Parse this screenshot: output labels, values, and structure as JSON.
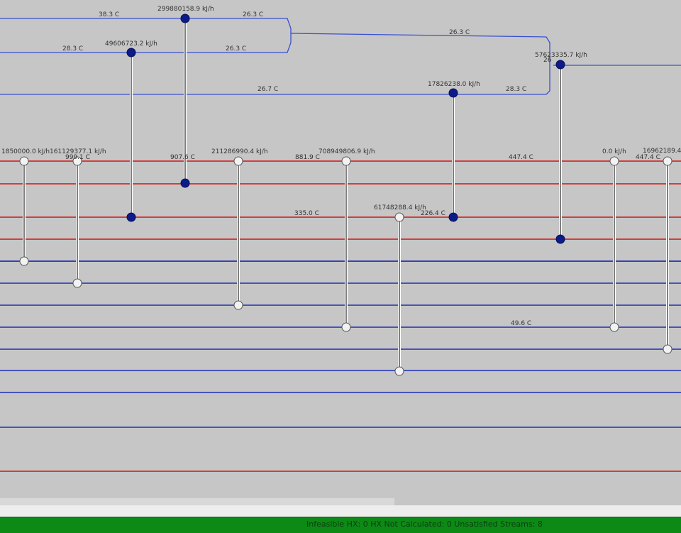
{
  "colors": {
    "background": "#c6c6c6",
    "hot_stream": "#d52a2a",
    "cold_stream": "#1e2fb5",
    "utility_stream": "#3a4fd0",
    "hx_hot_node": "#0c1a8a",
    "hx_cold_node": "#f2f2f2",
    "status_bar": "#0d8a16"
  },
  "streams": [
    {
      "type": "utility"
    },
    {
      "type": "utility"
    },
    {
      "type": "utility"
    },
    {
      "type": "utility"
    },
    {
      "type": "hot"
    },
    {
      "type": "hot"
    },
    {
      "type": "hot"
    },
    {
      "type": "hot"
    },
    {
      "type": "cold"
    },
    {
      "type": "cold"
    },
    {
      "type": "cold"
    },
    {
      "type": "cold"
    },
    {
      "type": "cold"
    },
    {
      "type": "cold"
    },
    {
      "type": "cold"
    },
    {
      "type": "cold"
    },
    {
      "type": "hot"
    }
  ],
  "exchangers": [
    {
      "id": "hx1",
      "duty": "299880158.9 kJ/h",
      "from": "utility"
    },
    {
      "id": "hx2",
      "duty": "49606723.2 kJ/h",
      "from": "utility"
    },
    {
      "id": "hx3",
      "duty": "17826238.0 kJ/h",
      "from": "utility"
    },
    {
      "id": "hx4",
      "duty": "57623335.7 kJ/h",
      "from": "utility"
    },
    {
      "id": "hx5",
      "duty": "1850000.0 kJ/h",
      "from": "hot"
    },
    {
      "id": "hx6",
      "duty": "161129377.1 kJ/h",
      "from": "hot"
    },
    {
      "id": "hx7",
      "duty": "211286990.4 kJ/h",
      "from": "hot"
    },
    {
      "id": "hx8",
      "duty": "708949806.9 kJ/h",
      "from": "hot"
    },
    {
      "id": "hx9",
      "duty": "61748288.4 kJ/h",
      "from": "hot"
    },
    {
      "id": "hx10",
      "duty": "0.0 kJ/h",
      "from": "hot"
    },
    {
      "id": "hx11",
      "duty": "16962189.4",
      "from": "hot"
    }
  ],
  "temperatures": [
    "38.3 C",
    "26.3 C",
    "28.3 C",
    "26.3 C",
    "26.3 C",
    "26.7 C",
    "28.3 C",
    "26",
    "999.1 C",
    "907.6 C",
    "881.9 C",
    "447.4 C",
    "447.4 C",
    "335.0 C",
    "226.4 C",
    "49.6 C"
  ],
  "status": {
    "text": "Infeasible HX: 0  HX Not Calculated: 0  Unsatisfied Streams: 8"
  }
}
